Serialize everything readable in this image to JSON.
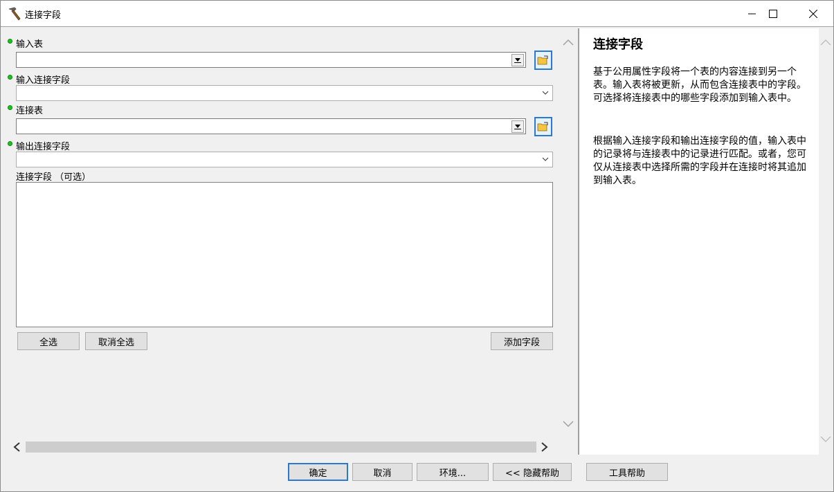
{
  "window": {
    "title": "连接字段",
    "icons": {
      "app": "hammer-icon",
      "minimize": "minimize-icon",
      "maximize": "maximize-icon",
      "close": "close-icon"
    }
  },
  "form": {
    "input_table_label": "输入表",
    "input_join_field_label": "输入连接字段",
    "join_table_label": "连接表",
    "output_join_field_label": "输出连接字段",
    "join_fields_label": "连接字段 （可选）",
    "input_table_value": "",
    "input_join_field_value": "",
    "join_table_value": "",
    "output_join_field_value": "",
    "select_all_label": "全选",
    "deselect_all_label": "取消全选",
    "add_field_label": "添加字段"
  },
  "help": {
    "title": "连接字段",
    "paragraph1": "基于公用属性字段将一个表的内容连接到另一个表。输入表将被更新，从而包含连接表中的字段。可选择将连接表中的哪些字段添加到输入表中。",
    "paragraph2": "根据输入连接字段和输出连接字段的值，输入表中的记录将与连接表中的记录进行匹配。或者，您可仅从连接表中选择所需的字段并在连接时将其追加到输入表。"
  },
  "footer": {
    "ok_label": "确定",
    "cancel_label": "取消",
    "environments_label": "环境...",
    "hide_help_label": "<< 隐藏帮助",
    "tool_help_label": "工具帮助"
  },
  "colors": {
    "required_dot": "#1ec41e",
    "accent_border": "#2b78d0",
    "panel_bg": "#f0f0f0"
  }
}
